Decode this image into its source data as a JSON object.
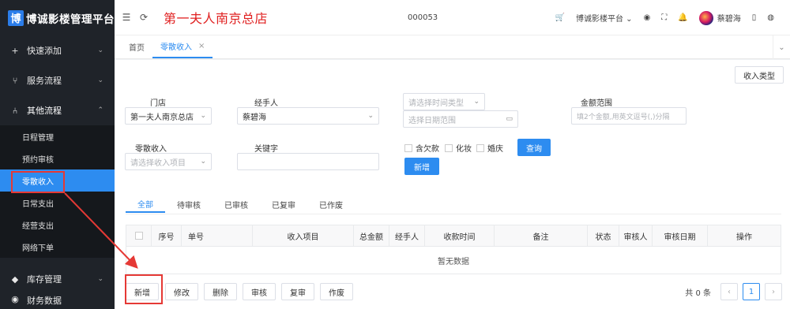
{
  "sidebar": {
    "logo_badge": "博",
    "logo_text": "博诚影楼管理平台",
    "groups": [
      {
        "label": "快速添加",
        "icon": "plus-icon"
      },
      {
        "label": "服务流程",
        "icon": "flow-icon"
      },
      {
        "label": "其他流程",
        "icon": "branch-icon"
      }
    ],
    "sub_items": [
      "日程管理",
      "预约审核",
      "零散收入",
      "日常支出",
      "经营支出",
      "网络下单"
    ],
    "active_sub": "零散收入",
    "bottom_group": {
      "label": "库存管理",
      "icon": "box-icon"
    },
    "cut_group": {
      "label": "财务数据"
    }
  },
  "header": {
    "store_title": "第一夫人南京总店",
    "store_code": "000053",
    "platform": "博诚影楼平台",
    "user": "蔡碧海"
  },
  "tabs": {
    "home": "首页",
    "active": "零散收入",
    "close": "×"
  },
  "filters": {
    "income_type_button": "收入类型",
    "store_label": "门店",
    "store_value": "第一夫人南京总店",
    "handler_label": "经手人",
    "handler_value": "蔡碧海",
    "time_type_placeholder": "请选择时间类型",
    "date_range_placeholder": "选择日期范围",
    "amount_label": "金额范围",
    "amount_placeholder": "填2个金额,用英文逗号(,)分隔",
    "misc_income_label": "零散收入",
    "misc_income_placeholder": "请选择收入项目",
    "keyword_label": "关键字",
    "checkboxes": [
      "含欠款",
      "化妆",
      "婚庆"
    ],
    "query_button": "查询",
    "new_button": "新增"
  },
  "status_tabs": [
    "全部",
    "待审核",
    "已审核",
    "已复审",
    "已作废"
  ],
  "table": {
    "columns": [
      "",
      "序号",
      "单号",
      "收入项目",
      "总金额",
      "经手人",
      "收款时间",
      "备注",
      "状态",
      "审核人",
      "审核日期",
      "操作"
    ],
    "empty_text": "暂无数据"
  },
  "actions": [
    "新增",
    "修改",
    "删除",
    "审核",
    "复审",
    "作废"
  ],
  "pager": {
    "total": "共 0 条",
    "current": "1",
    "prev": "‹",
    "next": "›"
  },
  "colors": {
    "accent": "#2d8cf0",
    "title_red": "#e02020",
    "annotation_red": "#e53935"
  }
}
